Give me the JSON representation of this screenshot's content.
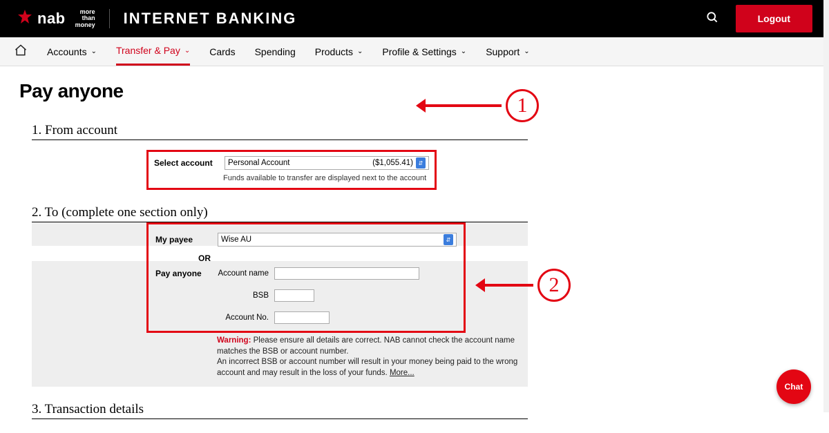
{
  "topbar": {
    "brand": "nab",
    "tagline_l1": "more",
    "tagline_l2": "than",
    "tagline_l3": "money",
    "product_title": "INTERNET BANKING",
    "logout": "Logout"
  },
  "nav": {
    "items": [
      {
        "label": "Accounts",
        "chev": true
      },
      {
        "label": "Transfer & Pay",
        "chev": true,
        "active": true
      },
      {
        "label": "Cards",
        "chev": false
      },
      {
        "label": "Spending",
        "chev": false
      },
      {
        "label": "Products",
        "chev": true
      },
      {
        "label": "Profile & Settings",
        "chev": true
      },
      {
        "label": "Support",
        "chev": true
      }
    ]
  },
  "page": {
    "title": "Pay anyone"
  },
  "step1": {
    "heading": "1. From account",
    "select_label": "Select account",
    "account_name": "Personal Account",
    "balance": "($1,055.41)",
    "hint": "Funds available to transfer are displayed next to the account",
    "annot_num": "1"
  },
  "step2": {
    "heading": "2. To (complete one section only)",
    "my_payee_label": "My payee",
    "payee_value": "Wise AU",
    "or": "OR",
    "pay_anyone_label": "Pay anyone",
    "acc_name_label": "Account name",
    "bsb_label": "BSB",
    "acc_no_label": "Account No.",
    "warning_label": "Warning:",
    "warning_text_1": " Please ensure all details are correct. NAB cannot check the account name matches the BSB or account number.",
    "warning_text_2": "An incorrect BSB or account number will result in your money being paid to the wrong account and may result in the loss of your funds. ",
    "more": "More...",
    "annot_num": "2"
  },
  "step3": {
    "heading": "3. Transaction details"
  },
  "chat": {
    "label": "Chat"
  }
}
